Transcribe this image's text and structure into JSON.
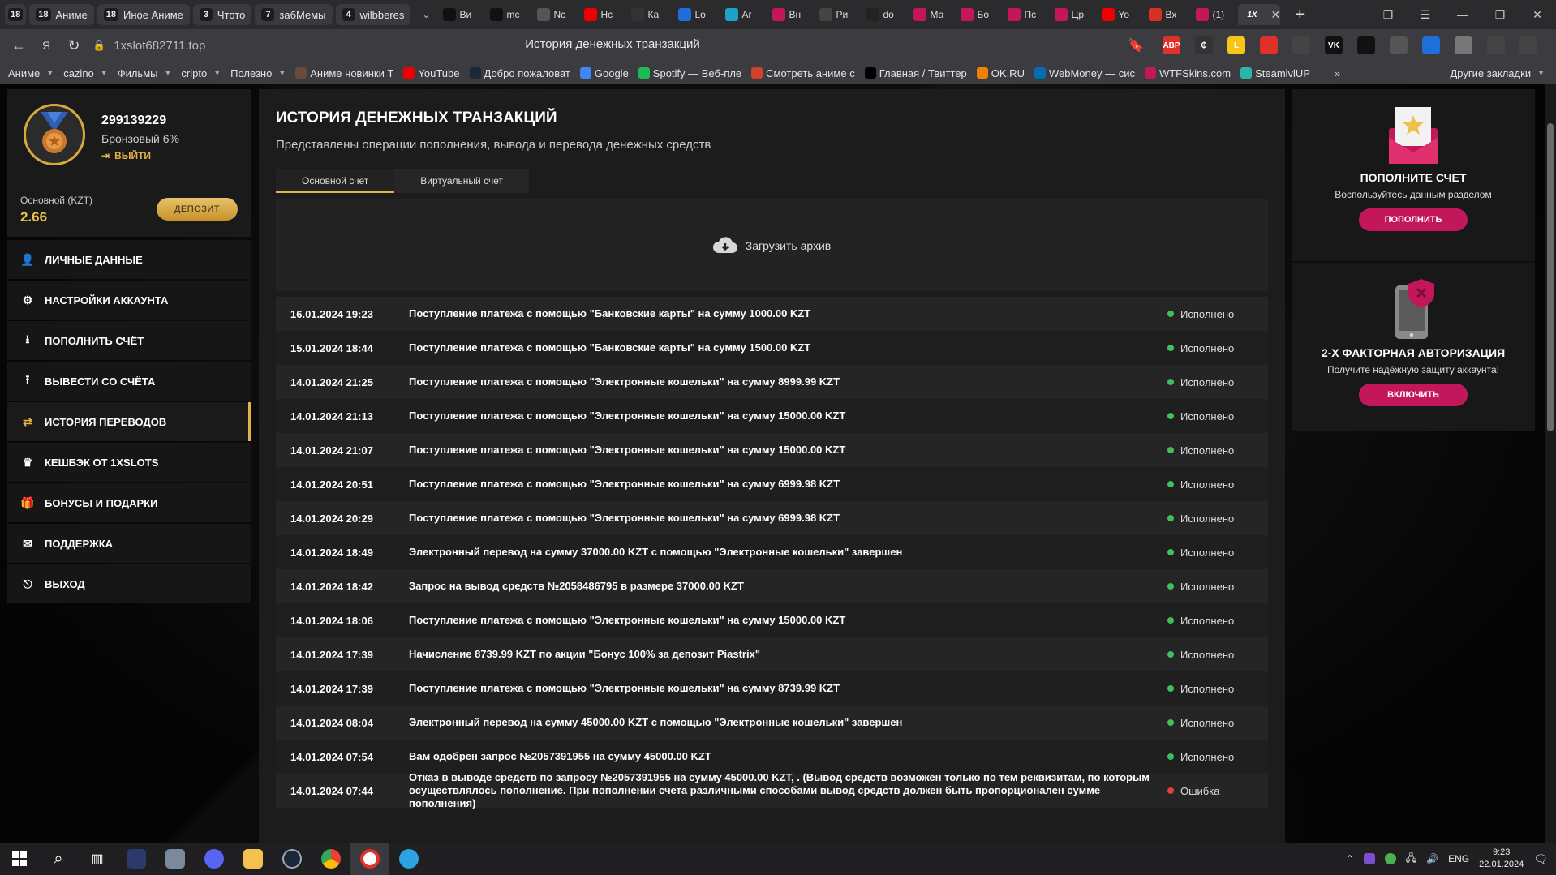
{
  "browser": {
    "tab_groups": [
      {
        "count": "18",
        "label": "Аниме"
      },
      {
        "count": "18",
        "label": "Иное Аниме"
      },
      {
        "count": "3",
        "label": "Чтото"
      },
      {
        "count": "7",
        "label": "забМемы"
      },
      {
        "count": "4",
        "label": "wilbberes"
      }
    ],
    "tabs": [
      {
        "label": "Ви",
        "color": "#111"
      },
      {
        "label": "mc",
        "color": "#111"
      },
      {
        "label": "Nc",
        "color": "#555"
      },
      {
        "label": "Нс",
        "color": "#e00"
      },
      {
        "label": "Ка",
        "color": "#333"
      },
      {
        "label": "Lo",
        "color": "#1e6fd9"
      },
      {
        "label": "Ar",
        "color": "#1fa2c8"
      },
      {
        "label": "Вн",
        "color": "#c2185b"
      },
      {
        "label": "Ри",
        "color": "#444"
      },
      {
        "label": "do",
        "color": "#222"
      },
      {
        "label": "Ма",
        "color": "#c2185b"
      },
      {
        "label": "Бо",
        "color": "#c2185b"
      },
      {
        "label": "Пс",
        "color": "#c2185b"
      },
      {
        "label": "Цр",
        "color": "#c2185b"
      },
      {
        "label": "Yo",
        "color": "#e00"
      },
      {
        "label": "Вх",
        "color": "#d93025"
      },
      {
        "label": "(1)",
        "color": "#c2185b"
      }
    ],
    "active_tab_label": "1X",
    "url": "1xslot682711.top",
    "page_title": "История денежных транзакций",
    "bookmarks": [
      {
        "label": "Аниме",
        "folder": true
      },
      {
        "label": "cazino",
        "folder": true
      },
      {
        "label": "Фильмы",
        "folder": true
      },
      {
        "label": "cripto",
        "folder": true
      },
      {
        "label": "Полезно",
        "folder": true
      },
      {
        "label": "Аниме новинки Т",
        "color": "#6a4b3a"
      },
      {
        "label": "YouTube",
        "color": "#e00"
      },
      {
        "label": "Добро пожаловат",
        "color": "#1b2838"
      },
      {
        "label": "Google",
        "color": "#4285f4"
      },
      {
        "label": "Spotify — Веб-пле",
        "color": "#1db954"
      },
      {
        "label": "Смотреть аниме с",
        "color": "#d0402f"
      },
      {
        "label": "Главная / Твиттер",
        "color": "#000"
      },
      {
        "label": "OK.RU",
        "color": "#ee8208"
      },
      {
        "label": "WebMoney — сис",
        "color": "#036cb5"
      },
      {
        "label": "WTFSkins.com",
        "color": "#c2185b"
      },
      {
        "label": "SteamlvlUP",
        "color": "#2ab7a9"
      }
    ],
    "bookmarks_other": "Другие закладки",
    "extensions": [
      "ABP",
      "₵",
      "L",
      "",
      "",
      "VK",
      "",
      "",
      "",
      "",
      "",
      ""
    ]
  },
  "profile": {
    "user_id": "299139229",
    "rank": "Бронзовый 6%",
    "logout_label": "ВЫЙТИ",
    "account_label": "Основной (KZT)",
    "balance": "2.66",
    "deposit_button": "ДЕПОЗИТ"
  },
  "menu": [
    {
      "label": "Личные данные",
      "icon": "user-plus-icon",
      "glyph": "👤"
    },
    {
      "label": "Настройки аккаунта",
      "icon": "settings-icon",
      "glyph": "⚙"
    },
    {
      "label": "Пополнить счёт",
      "icon": "download-icon",
      "glyph": "⭳"
    },
    {
      "label": "Вывести со счёта",
      "icon": "upload-icon",
      "glyph": "⭱"
    },
    {
      "label": "История переводов",
      "icon": "transfer-icon",
      "glyph": "⇄",
      "active": true
    },
    {
      "label": "Кешбэк от 1XSLOTS",
      "icon": "crown-icon",
      "glyph": "♛"
    },
    {
      "label": "Бонусы и подарки",
      "icon": "gift-icon",
      "glyph": "🎁"
    },
    {
      "label": "Поддержка",
      "icon": "mail-icon",
      "glyph": "✉"
    },
    {
      "label": "Выход",
      "icon": "exit-icon",
      "glyph": "⎋"
    }
  ],
  "main": {
    "title": "ИСТОРИЯ ДЕНЕЖНЫХ ТРАНЗАКЦИЙ",
    "subtitle": "Представлены операции пополнения, вывода и перевода денежных средств",
    "tabs": [
      "Основной счет",
      "Виртуальный счет"
    ],
    "archive_label": "Загрузить архив",
    "transactions": [
      {
        "date": "16.01.2024 19:23",
        "text": "Поступление платежа с помощью \"Банковские карты\" на сумму 1000.00 KZT",
        "status": "Исполнено",
        "ok": true
      },
      {
        "date": "15.01.2024 18:44",
        "text": "Поступление платежа с помощью \"Банковские карты\" на сумму 1500.00 KZT",
        "status": "Исполнено",
        "ok": true
      },
      {
        "date": "14.01.2024 21:25",
        "text": "Поступление платежа с помощью \"Электронные кошельки\" на сумму 8999.99 KZT",
        "status": "Исполнено",
        "ok": true
      },
      {
        "date": "14.01.2024 21:13",
        "text": "Поступление платежа с помощью \"Электронные кошельки\" на сумму 15000.00 KZT",
        "status": "Исполнено",
        "ok": true
      },
      {
        "date": "14.01.2024 21:07",
        "text": "Поступление платежа с помощью \"Электронные кошельки\" на сумму 15000.00 KZT",
        "status": "Исполнено",
        "ok": true
      },
      {
        "date": "14.01.2024 20:51",
        "text": "Поступление платежа с помощью \"Электронные кошельки\" на сумму 6999.98 KZT",
        "status": "Исполнено",
        "ok": true
      },
      {
        "date": "14.01.2024 20:29",
        "text": "Поступление платежа с помощью \"Электронные кошельки\" на сумму 6999.98 KZT",
        "status": "Исполнено",
        "ok": true
      },
      {
        "date": "14.01.2024 18:49",
        "text": "Электронный перевод на сумму 37000.00 KZT с помощью \"Электронные кошельки\" завершен",
        "status": "Исполнено",
        "ok": true
      },
      {
        "date": "14.01.2024 18:42",
        "text": "Запрос на вывод средств №2058486795 в размере 37000.00 KZT",
        "status": "Исполнено",
        "ok": true
      },
      {
        "date": "14.01.2024 18:06",
        "text": "Поступление платежа с помощью \"Электронные кошельки\" на сумму 15000.00 KZT",
        "status": "Исполнено",
        "ok": true
      },
      {
        "date": "14.01.2024 17:39",
        "text": "Начисление 8739.99 KZT по акции \"Бонус 100% за депозит Piastrix\"",
        "status": "Исполнено",
        "ok": true
      },
      {
        "date": "14.01.2024 17:39",
        "text": "Поступление платежа с помощью \"Электронные кошельки\" на сумму 8739.99 KZT",
        "status": "Исполнено",
        "ok": true
      },
      {
        "date": "14.01.2024 08:04",
        "text": "Электронный перевод на сумму 45000.00 KZT с помощью \"Электронные кошельки\" завершен",
        "status": "Исполнено",
        "ok": true
      },
      {
        "date": "14.01.2024 07:54",
        "text": "Вам одобрен запрос №2057391955 на сумму 45000.00 KZT",
        "status": "Исполнено",
        "ok": true
      },
      {
        "date": "14.01.2024 07:44",
        "text": "Отказ в выводе средств по запросу №2057391955 на сумму 45000.00 KZT, . (Вывод средств возможен только по тем реквизитам, по которым осуществлялось пополнение. При пополнении счета различными способами вывод средств должен быть пропорционален сумме пополнения)",
        "status": "Ошибка",
        "ok": false
      }
    ]
  },
  "promo": {
    "deposit": {
      "title": "ПОПОЛНИТЕ СЧЕТ",
      "text": "Воспользуйтесь данным разделом",
      "button": "ПОПОЛНИТЬ"
    },
    "twofa": {
      "title": "2-Х ФАКТОРНАЯ АВТОРИЗАЦИЯ",
      "text": "Получите надёжную защиту аккаунта!",
      "button": "ВКЛЮЧИТЬ"
    }
  },
  "taskbar": {
    "lang": "ENG",
    "time": "9:23",
    "date": "22.01.2024"
  }
}
